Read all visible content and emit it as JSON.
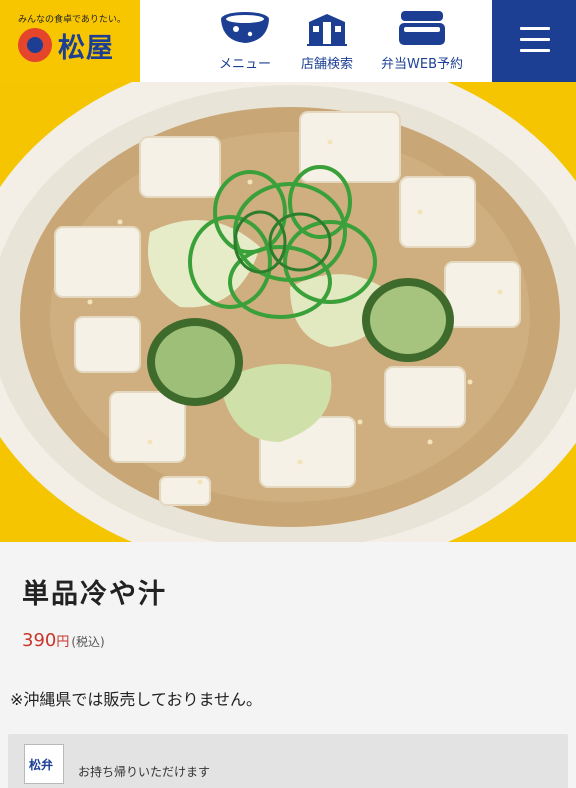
{
  "header": {
    "logo_tagline": "みんなの食卓でありたい。",
    "logo_text": "松屋",
    "nav": [
      {
        "label": "メニュー",
        "icon": "bowl-icon"
      },
      {
        "label": "店舗検索",
        "icon": "store-icon"
      },
      {
        "label": "弁当WEB予約",
        "icon": "bento-box-icon"
      }
    ],
    "menu_icon": "hamburger-menu-icon"
  },
  "product": {
    "title": "単品冷や汁",
    "price": "390",
    "yen": "円",
    "tax_note": "(税込)",
    "availability_note": "※沖縄県では販売しておりません。",
    "takeout_badge": "松弁",
    "takeout_text": "お持ち帰りいただけます"
  },
  "colors": {
    "brand_blue": "#1c3f94",
    "brand_yellow": "#f7c600",
    "brand_red": "#e4452b",
    "price_red": "#c8362b"
  }
}
